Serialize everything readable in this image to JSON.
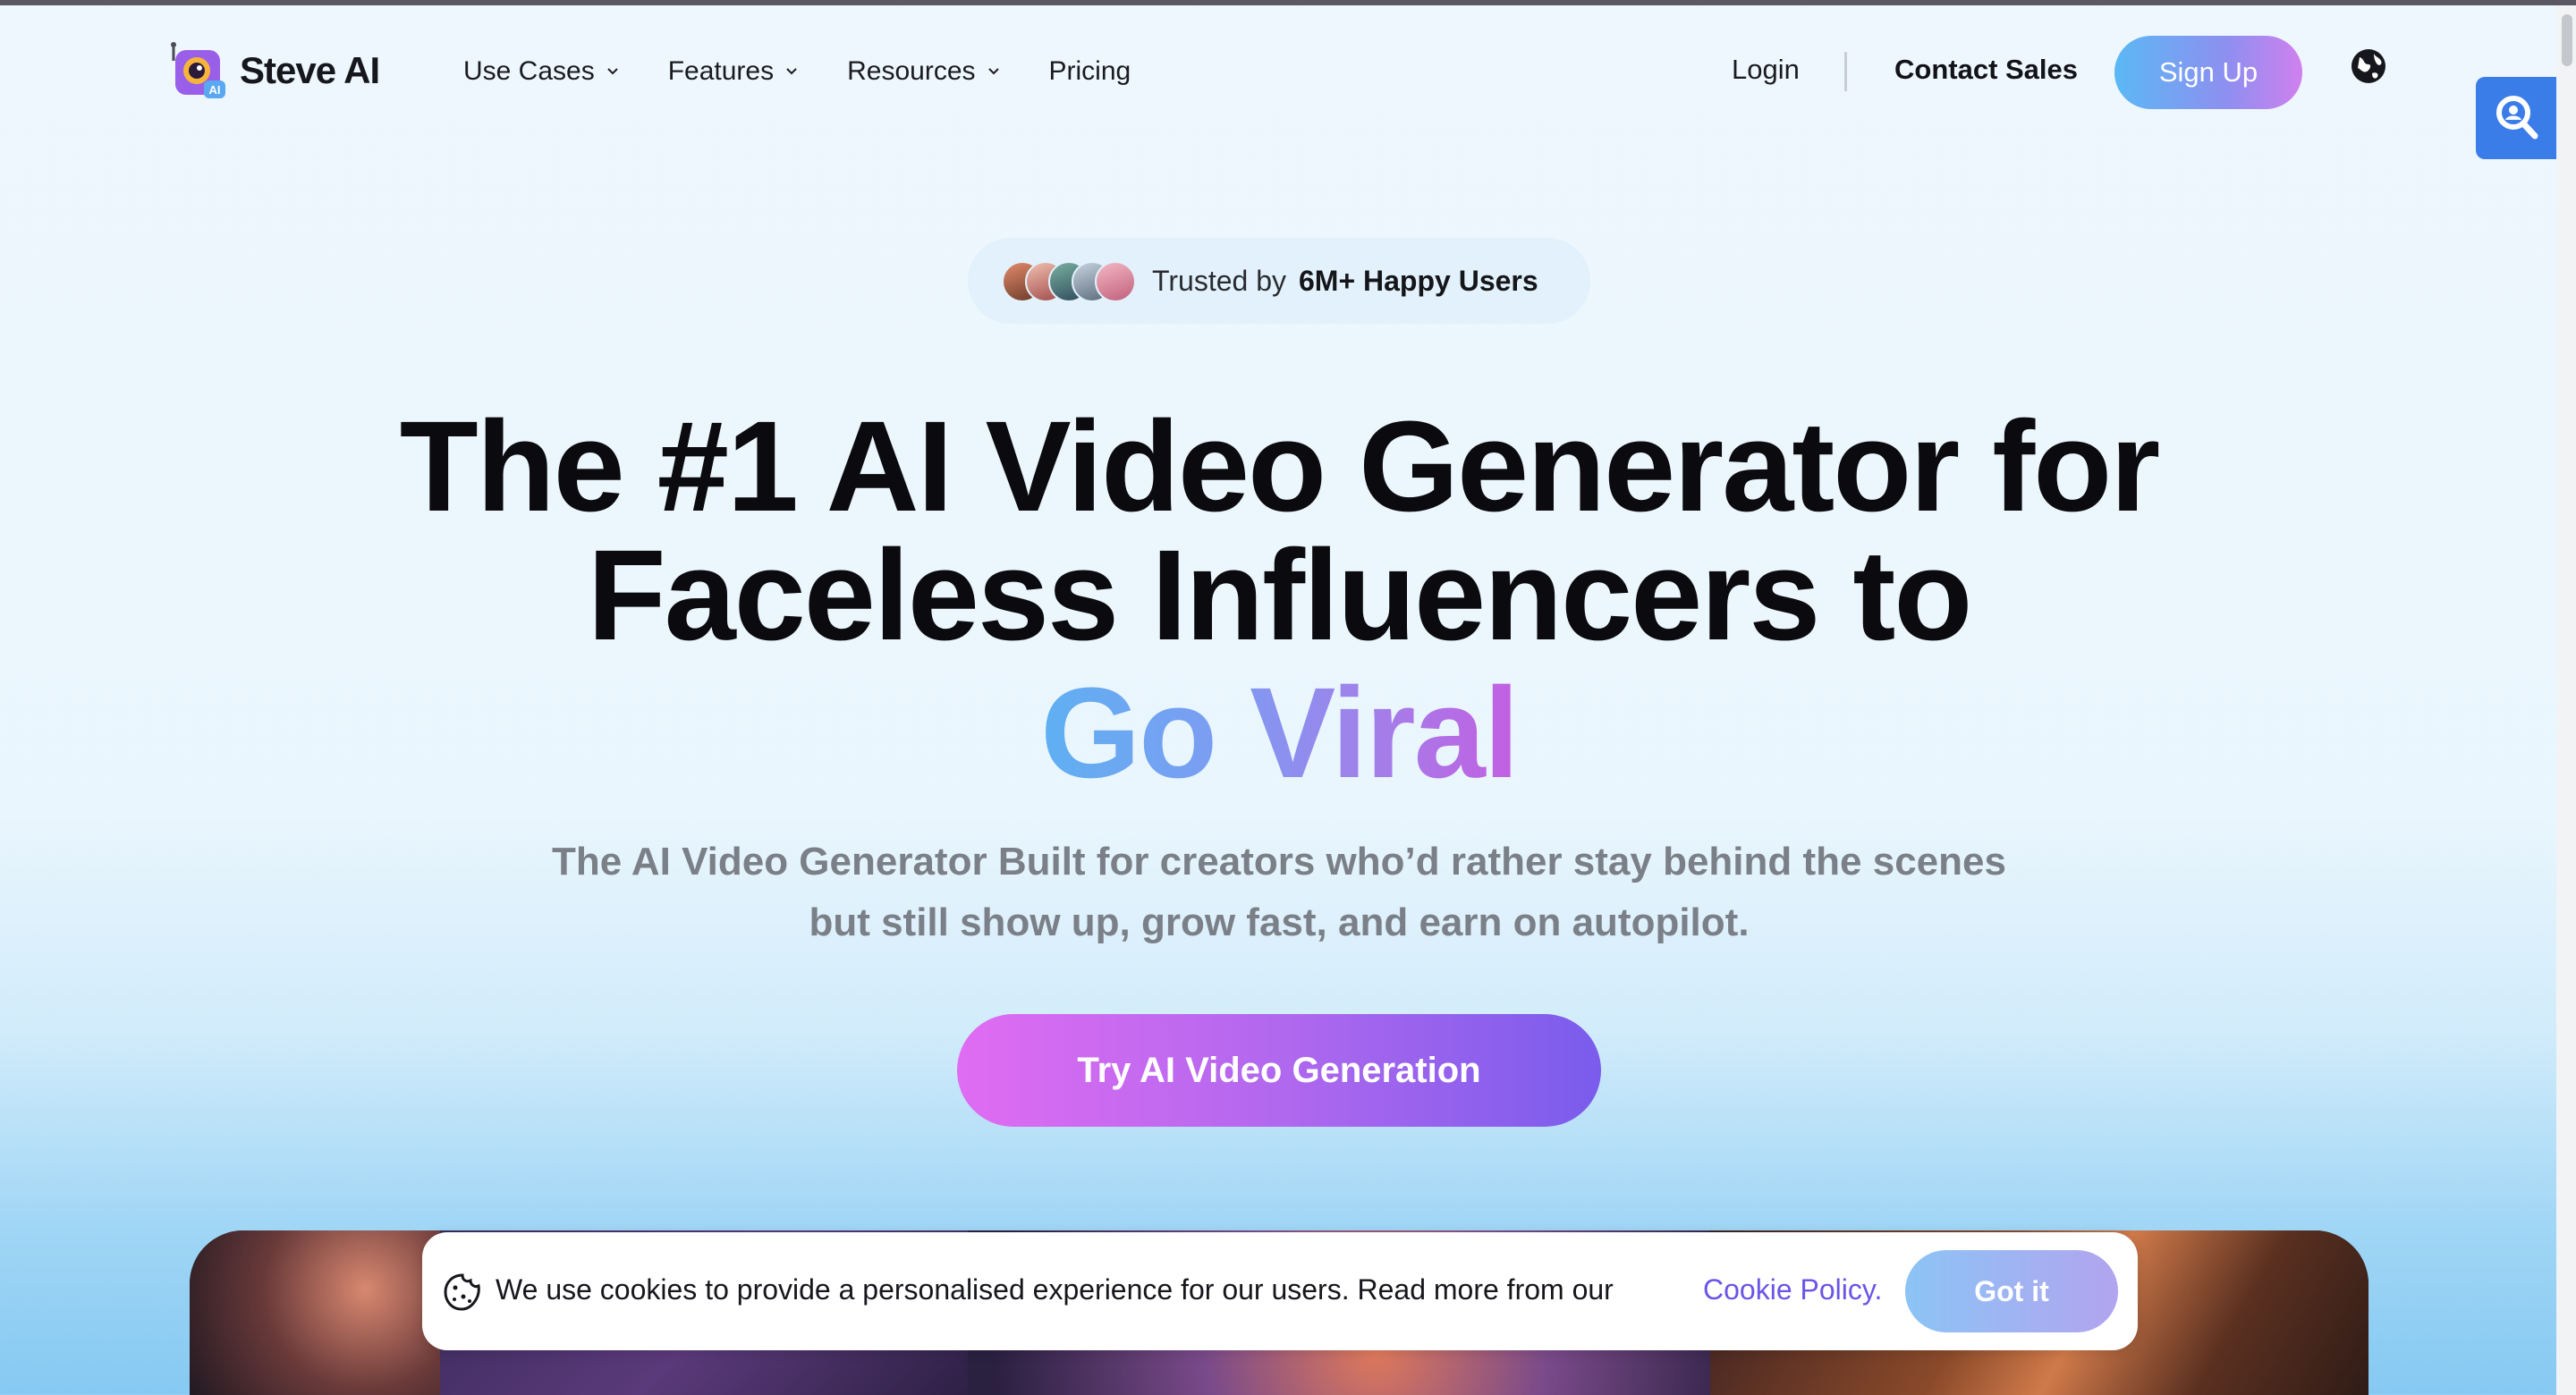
{
  "header": {
    "logo_text": "Steve AI",
    "nav": [
      {
        "label": "Use Cases",
        "has_dropdown": true
      },
      {
        "label": "Features",
        "has_dropdown": true
      },
      {
        "label": "Resources",
        "has_dropdown": true
      },
      {
        "label": "Pricing",
        "has_dropdown": false
      }
    ],
    "login_label": "Login",
    "contact_label": "Contact Sales",
    "signup_label": "Sign Up",
    "language_icon": "globe-icon"
  },
  "side_widget": {
    "icon": "search-icon"
  },
  "hero": {
    "trusted_prefix": "Trusted by",
    "trusted_strong": "6M+ Happy Users",
    "headline_line1": "The #1 AI Video Generator for",
    "headline_line2": "Faceless Influencers to",
    "headline_highlight": "Go Viral",
    "subtitle_line1": "The AI Video Generator Built for creators who’d rather stay behind the scenes",
    "subtitle_line2": "but still show up, grow fast, and earn on autopilot.",
    "cta_label": "Try AI Video Generation"
  },
  "cookie_banner": {
    "icon": "cookie-icon",
    "text": "We use cookies to provide a personalised experience for our users. Read more from our",
    "link_label": "Cookie Policy.",
    "button_label": "Got it"
  },
  "colors": {
    "accent_purple": "#7a5cec",
    "accent_pink": "#e06cf2",
    "accent_blue": "#5bb8f5",
    "link": "#6a55e6"
  }
}
